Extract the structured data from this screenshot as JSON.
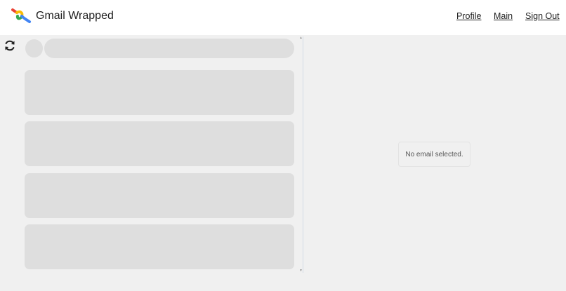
{
  "header": {
    "app_title": "Gmail Wrapped",
    "nav": {
      "profile": "Profile",
      "main": "Main",
      "sign_out": "Sign Out"
    }
  },
  "email_list": {
    "loading": true,
    "skeleton_card_count": 4
  },
  "detail": {
    "empty_message": "No email selected."
  },
  "icons": {
    "logo": "gmail-wrapped-logo",
    "refresh": "refresh-icon"
  },
  "colors": {
    "page_background": "#f0f0f0",
    "header_background": "#ffffff",
    "skeleton": "#dedede",
    "logo_red": "#ea4335",
    "logo_yellow": "#fbbc04",
    "logo_green": "#34a853",
    "logo_blue": "#4285f4"
  }
}
